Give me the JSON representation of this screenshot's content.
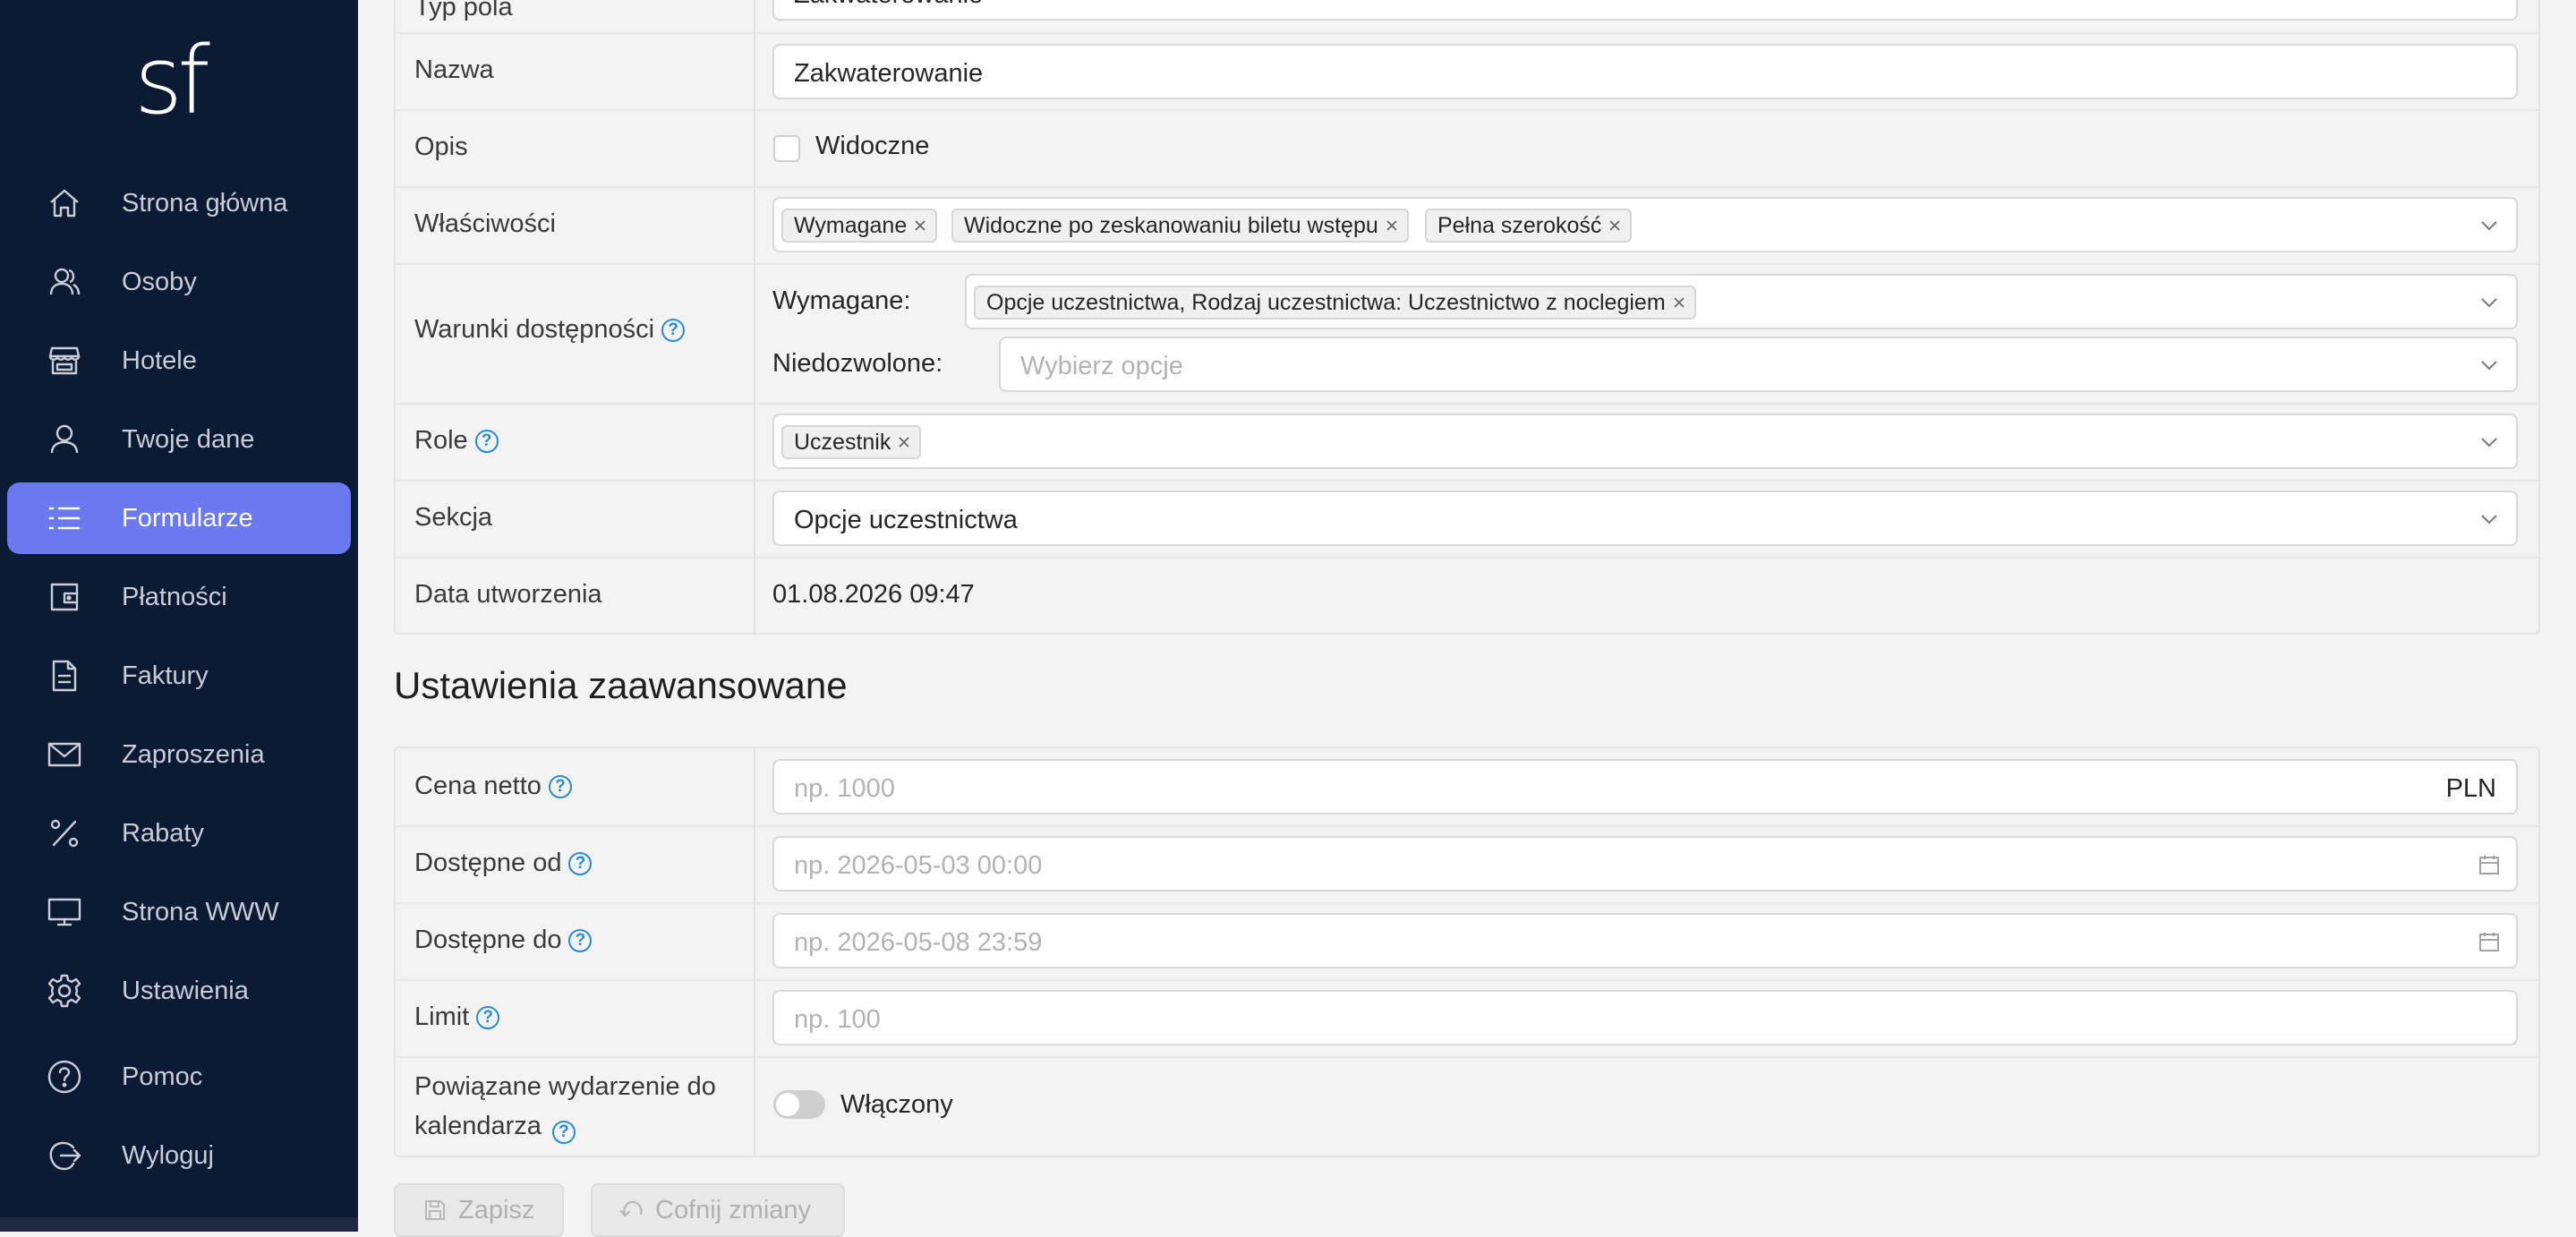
{
  "app": {
    "logo_text": "sf"
  },
  "sidebar": {
    "items": [
      {
        "label": "Strona główna",
        "icon": "home-icon"
      },
      {
        "label": "Osoby",
        "icon": "users-icon"
      },
      {
        "label": "Hotele",
        "icon": "store-icon"
      },
      {
        "label": "Twoje dane",
        "icon": "user-icon"
      },
      {
        "label": "Formularze",
        "icon": "list-icon",
        "active": true
      },
      {
        "label": "Płatności",
        "icon": "wallet-icon"
      },
      {
        "label": "Faktury",
        "icon": "document-icon"
      },
      {
        "label": "Zaproszenia",
        "icon": "mail-icon"
      },
      {
        "label": "Rabaty",
        "icon": "percent-icon"
      },
      {
        "label": "Strona WWW",
        "icon": "monitor-icon"
      },
      {
        "label": "Ustawienia",
        "icon": "gear-icon"
      },
      {
        "label": "Pomoc",
        "icon": "help-icon"
      },
      {
        "label": "Wyloguj",
        "icon": "logout-icon"
      }
    ]
  },
  "form": {
    "field_type": {
      "label": "Typ pola",
      "value": "Zakwaterowanie"
    },
    "name": {
      "label": "Nazwa",
      "value": "Zakwaterowanie"
    },
    "description": {
      "label": "Opis",
      "checkbox_label": "Widoczne",
      "checked": false
    },
    "properties": {
      "label": "Właściwości",
      "tags": [
        "Wymagane",
        "Widoczne po zeskanowaniu biletu wstępu",
        "Pełna szerokość"
      ]
    },
    "availability": {
      "label": "Warunki dostępności",
      "required_label": "Wymagane:",
      "required_tags": [
        "Opcje uczestnictwa, Rodzaj uczestnictwa: Uczestnictwo z noclegiem"
      ],
      "forbidden_label": "Niedozwolone:",
      "forbidden_placeholder": "Wybierz opcje"
    },
    "roles": {
      "label": "Role",
      "tags": [
        "Uczestnik"
      ]
    },
    "section": {
      "label": "Sekcja",
      "value": "Opcje uczestnictwa"
    },
    "created": {
      "label": "Data utworzenia",
      "value": "01.08.2026 09:47"
    }
  },
  "advanced": {
    "title": "Ustawienia zaawansowane",
    "net_price": {
      "label": "Cena netto",
      "placeholder": "np. 1000",
      "currency": "PLN"
    },
    "available_from": {
      "label": "Dostępne od",
      "placeholder": "np. 2026-05-03 00:00"
    },
    "available_to": {
      "label": "Dostępne do",
      "placeholder": "np. 2026-05-08 23:59"
    },
    "limit": {
      "label": "Limit",
      "placeholder": "np. 100"
    },
    "calendar_event": {
      "label_line1": "Powiązane wydarzenie do",
      "label_line2": "kalendarza",
      "toggle_label": "Włączony",
      "enabled": false
    }
  },
  "actions": {
    "save_label": "Zapisz",
    "revert_label": "Cofnij zmiany"
  },
  "colors": {
    "sidebar_bg": "#0b1b34",
    "accent": "#6a79f0",
    "help": "#2b8ad6"
  }
}
